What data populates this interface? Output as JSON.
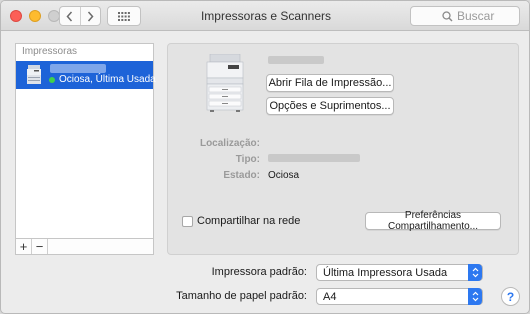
{
  "window": {
    "title": "Impressoras e Scanners",
    "icons": [
      "back-chevron-icon",
      "forward-chevron-icon",
      "grid-icon",
      "search-icon"
    ]
  },
  "search": {
    "placeholder": "Buscar"
  },
  "sidebar": {
    "header": "Impressoras",
    "items": [
      {
        "status": "Ociosa, Última Usada",
        "selected": true,
        "status_color": "#3fd14a"
      }
    ],
    "footer": {
      "add_label": "+",
      "remove_label": "−"
    }
  },
  "detail": {
    "open_queue_label": "Abrir Fila de Impressão...",
    "options_label": "Opções e Suprimentos...",
    "location_label": "Localização:",
    "location_value": "",
    "type_label": "Tipo:",
    "state_label": "Estado:",
    "state_value": "Ociosa",
    "share_label": "Compartilhar na rede",
    "share_checked": false,
    "sharing_prefs_label": "Preferências Compartilhamento..."
  },
  "bottom": {
    "default_printer_label": "Impressora padrão:",
    "default_printer_value": "Última Impressora Usada",
    "paper_size_label": "Tamanho de papel padrão:",
    "paper_size_value": "A4",
    "help_label": "?"
  },
  "colors": {
    "selection": "#1d63d8",
    "accent": "#2d78f0"
  }
}
